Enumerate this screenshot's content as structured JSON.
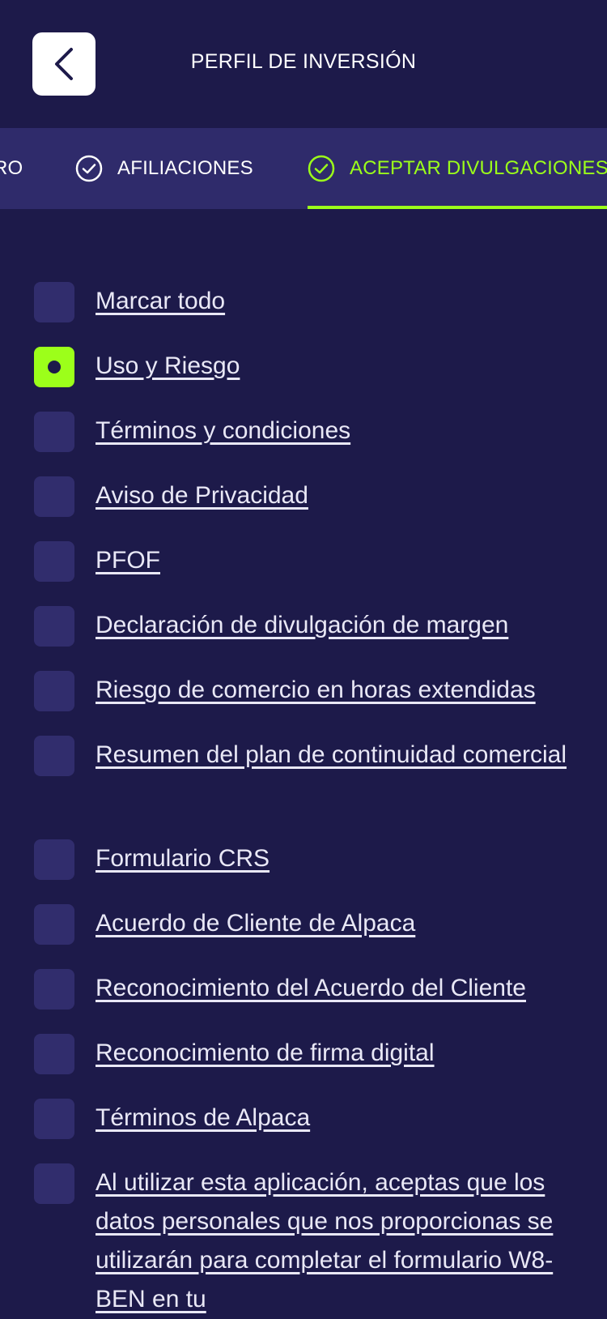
{
  "header": {
    "title": "PERFIL DE INVERSIÓN"
  },
  "tabs": [
    {
      "label": "RO",
      "state": "done"
    },
    {
      "label": "AFILIACIONES",
      "state": "done"
    },
    {
      "label": "ACEPTAR DIVULGACIONES",
      "state": "active"
    }
  ],
  "disclosures": [
    {
      "label": "Marcar todo",
      "checked": false
    },
    {
      "label": "Uso y Riesgo",
      "checked": true
    },
    {
      "label": "Términos y condiciones",
      "checked": false
    },
    {
      "label": "Aviso de Privacidad",
      "checked": false
    },
    {
      "label": "PFOF",
      "checked": false
    },
    {
      "label": "Declaración de divulgación de margen",
      "checked": false
    },
    {
      "label": "Riesgo de comercio en horas extendidas",
      "checked": false
    },
    {
      "label": "Resumen del plan de continuidad comercial",
      "checked": false
    },
    {
      "label": "Formulario CRS",
      "checked": false
    },
    {
      "label": "Acuerdo de Cliente de Alpaca",
      "checked": false
    },
    {
      "label": "Reconocimiento del Acuerdo del Cliente",
      "checked": false
    },
    {
      "label": "Reconocimiento de firma digital",
      "checked": false
    },
    {
      "label": "Términos de Alpaca",
      "checked": false
    },
    {
      "label": "Al utilizar esta aplicación, aceptas que los datos personales que nos proporcionas se utilizarán para completar el formulario W8-BEN en tu",
      "checked": false
    }
  ],
  "colors": {
    "background": "#1d1a4a",
    "tabbar": "#2f2b6b",
    "accent": "#9cff1a",
    "checkbox": "#312d6d"
  },
  "icons": {
    "back": "chevron-left-icon",
    "tab_done": "check-circle-icon"
  }
}
